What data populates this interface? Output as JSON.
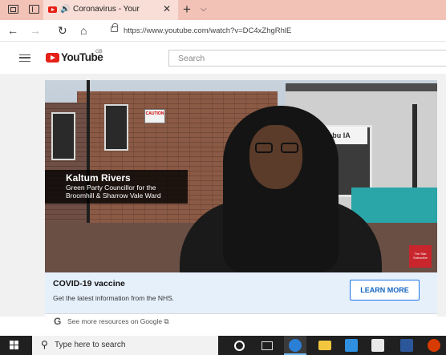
{
  "browser": {
    "tab": {
      "title": "Coronavirus - Your",
      "audio_icon": "🔊",
      "close_glyph": "✕"
    },
    "new_tab_glyph": "+",
    "tab_list_glyph": "⌵",
    "nav": {
      "back_glyph": "←",
      "forward_glyph": "→",
      "refresh_glyph": "↻",
      "home_glyph": "⌂"
    },
    "url": "https://www.youtube.com/watch?v=DC4xZhgRhlE"
  },
  "youtube": {
    "wordmark": "YouTube",
    "region": "GB",
    "search_placeholder": "Search",
    "brand_color": "#e62117"
  },
  "video": {
    "lower_third": {
      "name": "Kaltum Rivers",
      "role_line1": "Green Party Councillor for the",
      "role_line2": "Broomhill & Sharrow Vale Ward"
    },
    "caution_sign": "CAUTION",
    "shop_sign": "abu  IA",
    "channel_badge": "The Star Subscribe"
  },
  "info_panel": {
    "title": "COVID-19 vaccine",
    "subtitle": "Get the latest information from the NHS.",
    "button_label": "LEARN MORE",
    "footer_link": "See more resources on Google ⧉",
    "google_glyph": "G",
    "accent_color": "#1565c0"
  },
  "taskbar": {
    "search_text": "Type here to search",
    "search_glyph": "⚲",
    "icons": [
      "start-icon",
      "cortana-icon",
      "task-view-icon",
      "edge-icon",
      "file-explorer-icon",
      "store-icon",
      "photos-icon",
      "word-icon",
      "office-icon"
    ]
  }
}
